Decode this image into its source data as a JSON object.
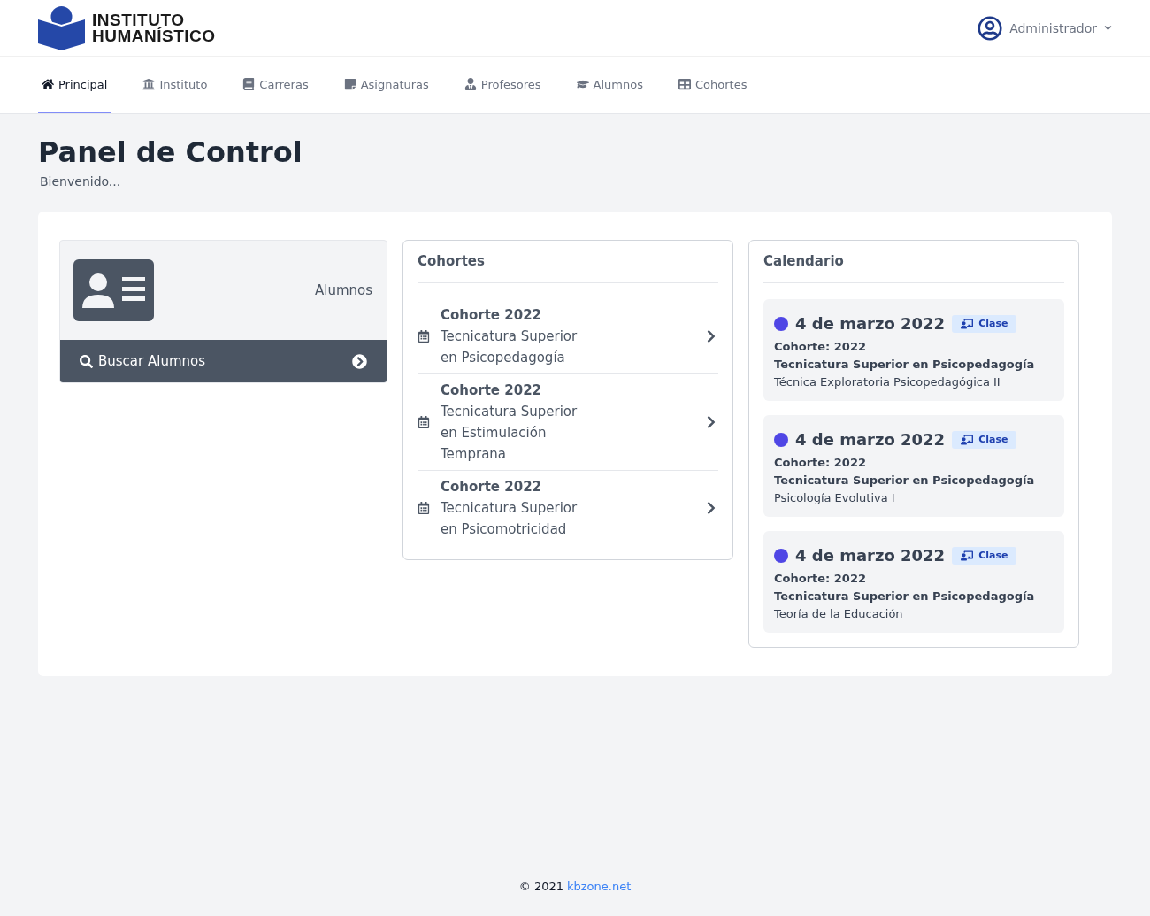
{
  "brand": {
    "line_1": "INSTITUTO",
    "line_2": "HUMANÍSTICO"
  },
  "user": {
    "name": "Administrador"
  },
  "tabs": [
    {
      "label": "Principal",
      "selected": true
    },
    {
      "label": "Instituto",
      "selected": false
    },
    {
      "label": "Carreras",
      "selected": false
    },
    {
      "label": "Asignaturas",
      "selected": false
    },
    {
      "label": "Profesores",
      "selected": false
    },
    {
      "label": "Alumnos",
      "selected": false
    },
    {
      "label": "Cohortes",
      "selected": false
    }
  ],
  "page": {
    "title": "Panel de Control",
    "subtitle": "Bienvenido..."
  },
  "students_card": {
    "label": "Alumnos",
    "button": "Buscar Alumnos"
  },
  "cohorts": {
    "title": "Cohortes",
    "items": [
      {
        "title": "Cohorte 2022",
        "lines": [
          "Tecnicatura Superior",
          "en Psicopedagogía"
        ]
      },
      {
        "title": "Cohorte 2022",
        "lines": [
          "Tecnicatura Superior",
          "en Estimulación",
          "Temprana"
        ]
      },
      {
        "title": "Cohorte 2022",
        "lines": [
          "Tecnicatura Superior",
          "en Psicomotricidad"
        ]
      }
    ]
  },
  "calendar": {
    "title": "Calendario",
    "events": [
      {
        "date": "4 de marzo 2022",
        "color": "#4f46e5",
        "badge": "Clase",
        "cohort": "Cohorte: 2022",
        "career": "Tecnicatura Superior en Psicopedagogía",
        "subject": "Técnica Exploratoria Psicopedagógica II"
      },
      {
        "date": "4 de marzo 2022",
        "color": "#4f46e5",
        "badge": "Clase",
        "cohort": "Cohorte: 2022",
        "career": "Tecnicatura Superior en Psicopedagogía",
        "subject": "Psicología Evolutiva I"
      },
      {
        "date": "4 de marzo 2022",
        "color": "#4f46e5",
        "badge": "Clase",
        "cohort": "Cohorte: 2022",
        "career": "Tecnicatura Superior en Psicopedagogía",
        "subject": "Teoría de la Educación"
      }
    ]
  },
  "footer": {
    "text": "© 2021",
    "link": "kbzone.net"
  }
}
